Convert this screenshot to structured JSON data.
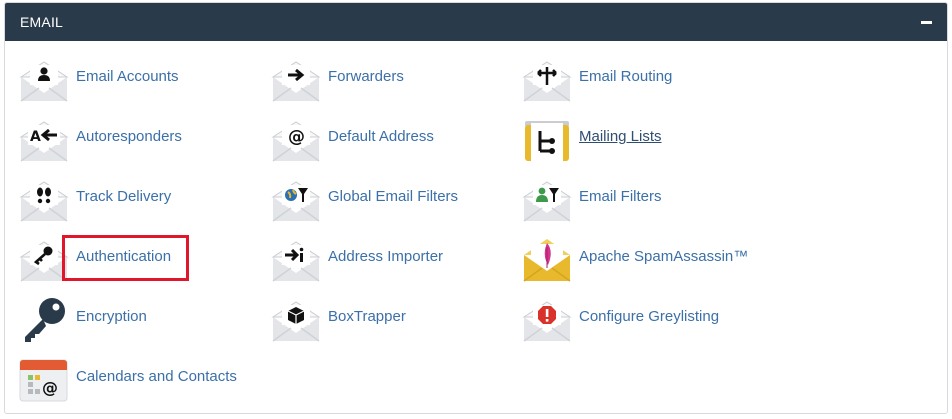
{
  "header": {
    "title": "EMAIL"
  },
  "colors": {
    "header_bg": "#293a4a",
    "link": "#3b70a8",
    "highlight": "#e0172a",
    "envelope": "#e3e5e8",
    "gold": "#e8b92c"
  },
  "items": [
    {
      "label": "Email Accounts",
      "icon": "user-envelope-icon"
    },
    {
      "label": "Forwarders",
      "icon": "arrow-envelope-icon"
    },
    {
      "label": "Email Routing",
      "icon": "routing-envelope-icon"
    },
    {
      "label": "Autoresponders",
      "icon": "autoreply-envelope-icon"
    },
    {
      "label": "Default Address",
      "icon": "at-envelope-icon"
    },
    {
      "label": "Mailing Lists",
      "icon": "mailing-list-icon"
    },
    {
      "label": "Track Delivery",
      "icon": "footprints-envelope-icon"
    },
    {
      "label": "Global Email Filters",
      "icon": "globe-filter-envelope-icon"
    },
    {
      "label": "Email Filters",
      "icon": "user-filter-envelope-icon"
    },
    {
      "label": "Authentication",
      "icon": "key-envelope-icon"
    },
    {
      "label": "Address Importer",
      "icon": "import-envelope-icon"
    },
    {
      "label": "Apache SpamAssassin™",
      "icon": "feather-envelope-icon"
    },
    {
      "label": "Encryption",
      "icon": "key-icon"
    },
    {
      "label": "BoxTrapper",
      "icon": "box-envelope-icon"
    },
    {
      "label": "Configure Greylisting",
      "icon": "alert-envelope-icon"
    },
    {
      "label": "Calendars and Contacts",
      "icon": "calendar-icon"
    }
  ]
}
